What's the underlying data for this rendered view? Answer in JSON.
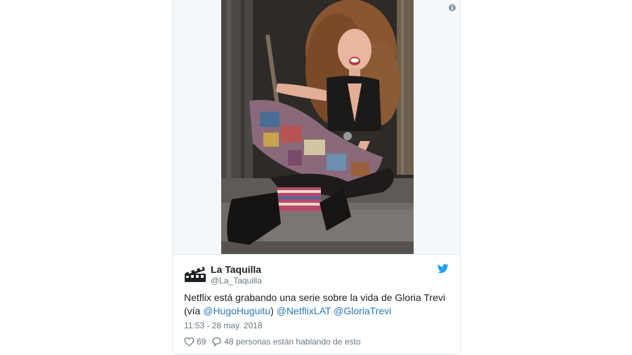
{
  "author": {
    "display_name": "La Taquilla",
    "screen_name": "@La_Taquilla"
  },
  "tweet": {
    "text_start": "Netflix está grabando una serie sobre la vida de Gloria Trevi (vía ",
    "mention_1": "@HugoHuguitu",
    "text_mid": ") ",
    "mention_2": "@NetflixLAT",
    "mention_3": "@GloriaTrevi",
    "timestamp": "11:53 - 28 may. 2018"
  },
  "actions": {
    "likes": "69",
    "conversation": "48 personas están hablando de esto"
  },
  "icons": {
    "info": "info-icon",
    "bird": "twitter-bird-icon",
    "like": "heart-icon",
    "reply": "speech-bubble-icon"
  },
  "colors": {
    "link": "#2b7bb9",
    "twitter_blue": "#1da1f2",
    "muted": "#697882"
  }
}
